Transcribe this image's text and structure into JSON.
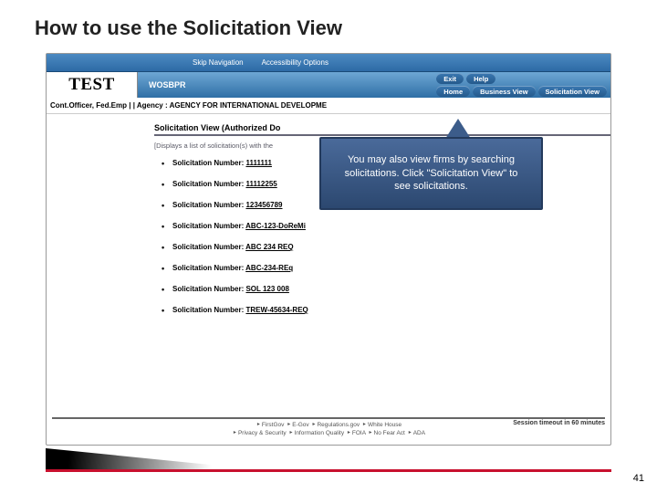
{
  "slide": {
    "title": "How to use the Solicitation View",
    "page_number": "41"
  },
  "topbar": {
    "skip": "Skip Navigation",
    "accessibility": "Accessibility Options"
  },
  "brand": {
    "logo": "TEST",
    "product": "WOSBPR"
  },
  "nav": {
    "exit": "Exit",
    "help": "Help",
    "home": "Home",
    "business": "Business View",
    "solicitation": "Solicitation View"
  },
  "userbar": "Cont.Officer, Fed.Emp | | Agency : AGENCY FOR INTERNATIONAL DEVELOPME",
  "section": {
    "header": "Solicitation View (Authorized Do",
    "desc": "[Displays a list of solicitation(s) with the"
  },
  "solicitations": {
    "label": "Solicitation Number:",
    "items": [
      "1111111",
      "11112255",
      "123456789",
      "ABC-123-DoReMi",
      "ABC 234  REQ",
      "ABC-234-REq",
      "SOL 123  008",
      "TREW-45634-REQ"
    ]
  },
  "callout": "You may also view firms by searching solicitations. Click \"Solicitation View\" to see solicitations.",
  "footer": {
    "row1": [
      "FirstGov",
      "E-Gov",
      "Regulations.gov",
      "White House"
    ],
    "row2": [
      "Privacy & Security",
      "Information Quality",
      "FOIA",
      "No Fear Act",
      "ADA"
    ],
    "session": "Session timeout in 60 minutes"
  }
}
